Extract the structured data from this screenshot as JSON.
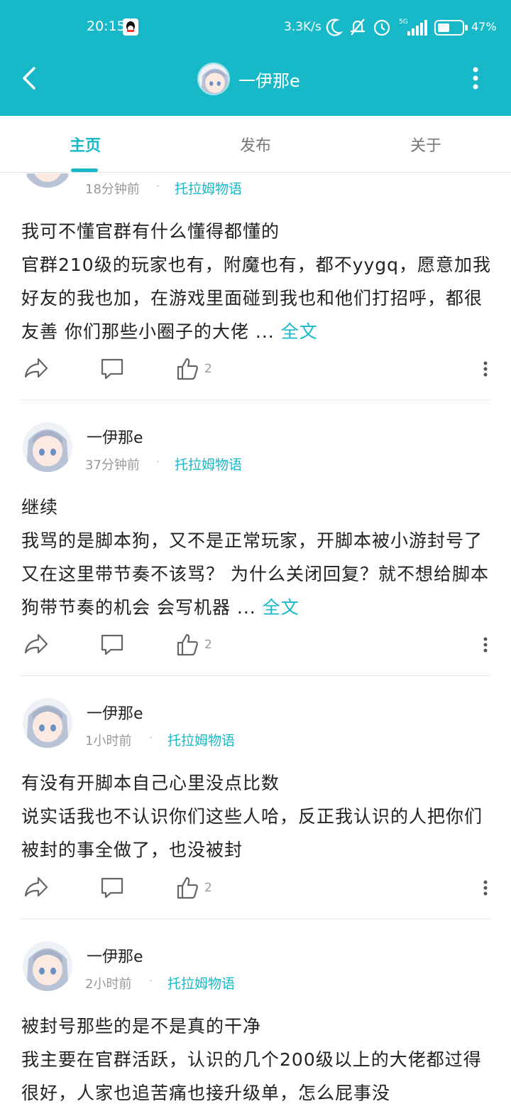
{
  "statusbar": {
    "time": "20:15",
    "net_speed": "3.3K/s",
    "signal": "5G",
    "battery": "47%"
  },
  "header": {
    "title": "一伊那e",
    "back_icon": "back-arrow-icon",
    "more_icon": "more-vertical-icon"
  },
  "tabs": [
    {
      "label": "主页",
      "active": true
    },
    {
      "label": "发布",
      "active": false
    },
    {
      "label": "关于",
      "active": false
    }
  ],
  "posts": [
    {
      "author": "",
      "time": "18分钟前",
      "topic": "托拉姆物语",
      "body": "我可不懂官群有什么懂得都懂的\n官群210级的玩家也有，附魔也有，都不yygq，愿意加我好友的我也加，在游戏里面碰到我也和他们打招呼，都很友善 你们那些小圈子的大佬 ...",
      "fulltext": "全文",
      "likes": "2"
    },
    {
      "author": "一伊那e",
      "time": "37分钟前",
      "topic": "托拉姆物语",
      "body": "继续\n我骂的是脚本狗，又不是正常玩家，开脚本被小游封号了又在这里带节奏不该骂？ 为什么关闭回复？就不想给脚本狗带节奏的机会 会写机器 ...",
      "fulltext": "全文",
      "likes": "2"
    },
    {
      "author": "一伊那e",
      "time": "1小时前",
      "topic": "托拉姆物语",
      "body": "有没有开脚本自己心里没点比数\n说实话我也不认识你们这些人哈，反正我认识的人把你们被封的事全做了，也没被封",
      "fulltext": "",
      "likes": "2"
    },
    {
      "author": "一伊那e",
      "time": "2小时前",
      "topic": "托拉姆物语",
      "body": "被封号那些的是不是真的干净\n我主要在官群活跃，认识的几个200级以上的大佬都过得很好，人家也追苦痛也接升级单，怎么屁事没",
      "fulltext": "",
      "likes": ""
    }
  ],
  "colors": {
    "accent": "#17b9c9",
    "muted": "#999999"
  }
}
